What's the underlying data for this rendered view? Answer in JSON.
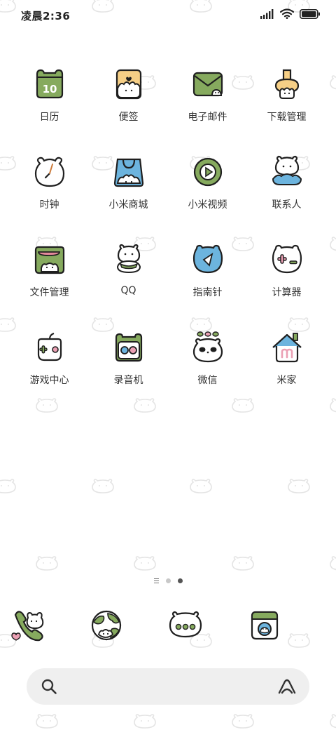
{
  "status_bar": {
    "time": "凌晨2:36"
  },
  "apps": [
    {
      "label": "日历",
      "icon": "calendar-icon"
    },
    {
      "label": "便签",
      "icon": "notes-icon"
    },
    {
      "label": "电子邮件",
      "icon": "email-icon"
    },
    {
      "label": "下载管理",
      "icon": "download-icon"
    },
    {
      "label": "时钟",
      "icon": "clock-icon"
    },
    {
      "label": "小米商城",
      "icon": "mi-store-icon"
    },
    {
      "label": "小米视频",
      "icon": "video-icon"
    },
    {
      "label": "联系人",
      "icon": "contacts-icon"
    },
    {
      "label": "文件管理",
      "icon": "file-manager-icon"
    },
    {
      "label": "QQ",
      "icon": "qq-icon"
    },
    {
      "label": "指南针",
      "icon": "compass-icon"
    },
    {
      "label": "计算器",
      "icon": "calculator-icon"
    },
    {
      "label": "游戏中心",
      "icon": "game-center-icon"
    },
    {
      "label": "录音机",
      "icon": "recorder-icon"
    },
    {
      "label": "微信",
      "icon": "wechat-icon"
    },
    {
      "label": "米家",
      "icon": "mi-home-icon"
    }
  ],
  "calendar_day": "10",
  "dock": [
    {
      "icon": "phone-icon"
    },
    {
      "icon": "browser-icon"
    },
    {
      "icon": "messages-icon"
    },
    {
      "icon": "camera-icon"
    }
  ],
  "page_indicator": {
    "pages": 2,
    "current": 2
  },
  "colors": {
    "green": "#86aa5e",
    "blue": "#6cb4de",
    "yellow": "#f6cf86",
    "pink": "#eba0b4",
    "outline": "#1f1f1f"
  }
}
